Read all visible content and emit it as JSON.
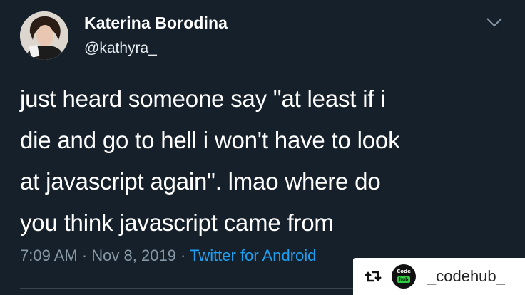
{
  "tweet": {
    "display_name": "Katerina Borodina",
    "handle": "@kathyra_",
    "text": "just heard someone say \"at least if i\ndie and go to hell i won't have to look\nat javascript again\". lmao where do\nyou think javascript came from",
    "time": "7:09 AM",
    "separator": " · ",
    "date": "Nov 8, 2019",
    "source": "Twitter for Android",
    "menu_icon": "chevron-down-icon",
    "avatar": "profile-photo"
  },
  "repost": {
    "icon": "repost-icon",
    "logo_line1": "Code",
    "logo_line2": "hub",
    "username": "_codehub_"
  },
  "colors": {
    "background": "#15202b",
    "text": "#ffffff",
    "muted": "#8899a6",
    "link": "#1da1f2"
  }
}
